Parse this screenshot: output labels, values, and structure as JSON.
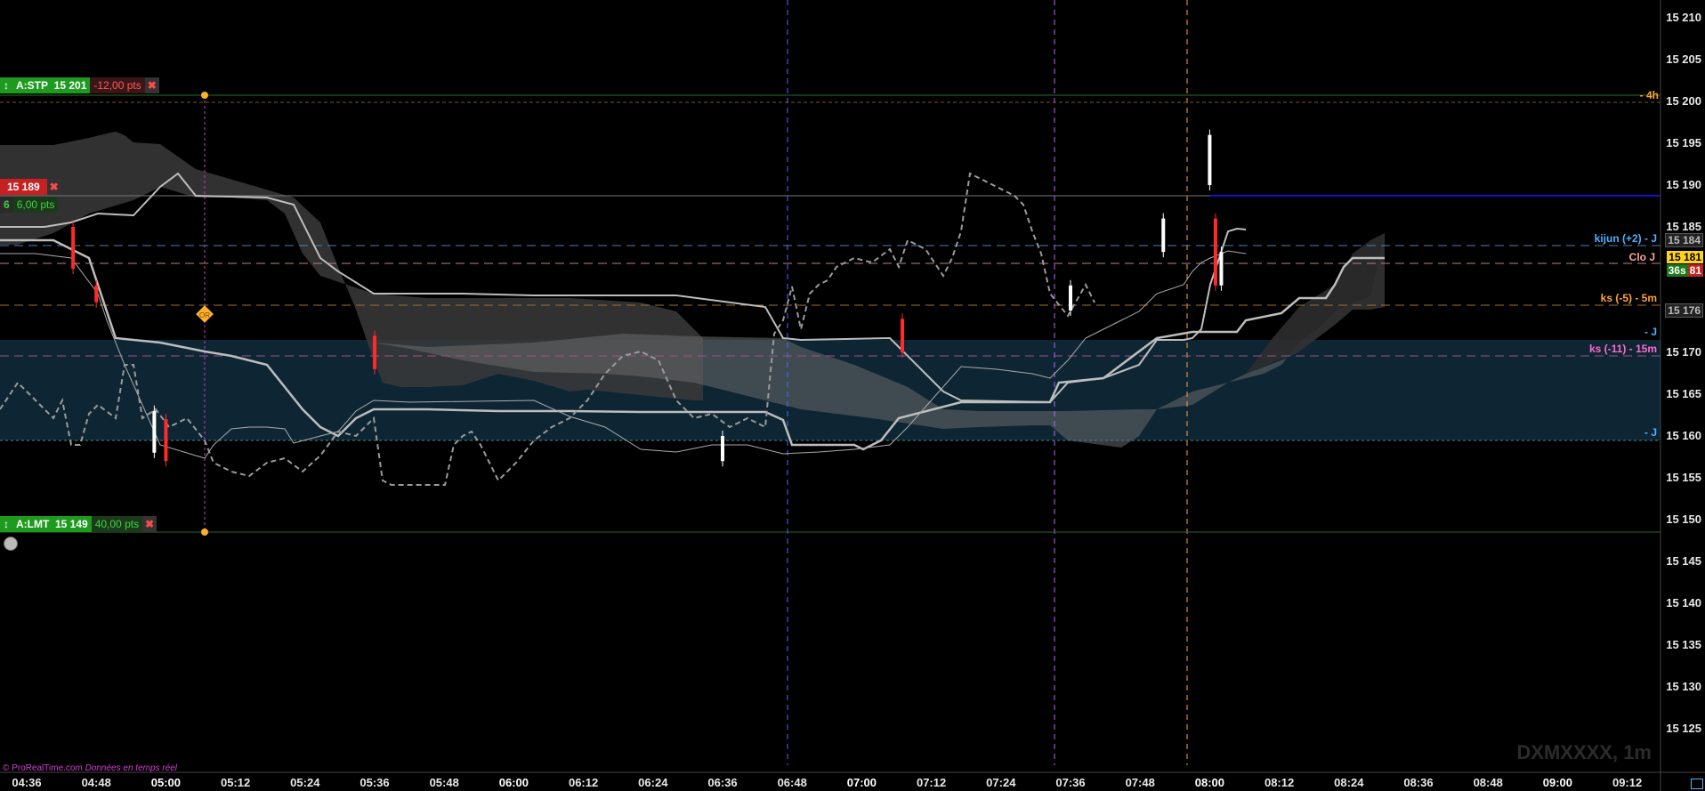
{
  "instrument": "DXMXXXX, 1m",
  "footer": {
    "site": "© ProRealTime.com",
    "note": "Données en temps réel"
  },
  "orders": {
    "stop": {
      "label": "A:STP",
      "price": "15 201",
      "pts": "-12,00 pts",
      "value": 15201
    },
    "limit": {
      "label": "A:LMT",
      "price": "15 149",
      "pts": "40,00 pts",
      "value": 15149
    },
    "position": {
      "price": "15 189",
      "qty": "6",
      "pts": "6,00 pts"
    }
  },
  "levels": [
    {
      "name": "4h",
      "label": "- 4h",
      "value": 15200,
      "color": "#ffa23a"
    },
    {
      "name": "kijun",
      "label": "kijun (+2) - J",
      "value": 15183.5,
      "color": "#4fb0ff"
    },
    {
      "name": "clo",
      "label": "Clo J",
      "value": 15181,
      "color": "#ffa0a0"
    },
    {
      "name": "ks5",
      "label": "ks (-5) - 5m",
      "value": 15176,
      "color": "#ffa23a"
    },
    {
      "name": "j1",
      "label": "- J",
      "value": 15173,
      "color": "#4fb0ff"
    },
    {
      "name": "ks11",
      "label": "ks (-11) - 15m",
      "value": 15171,
      "color": "#ff6ad0"
    },
    {
      "name": "j2",
      "label": "- J",
      "value": 15160,
      "color": "#4fb0ff"
    }
  ],
  "price_axis": {
    "ticks": [
      "15 210",
      "15 205",
      "15 200",
      "15 195",
      "15 190",
      "15 185",
      "15 180",
      "15 175",
      "15 170",
      "15 165",
      "15 160",
      "15 155",
      "15 150",
      "15 145",
      "15 140",
      "15 135",
      "15 130",
      "15 125"
    ],
    "last_price": "15 181",
    "countdown": "36s",
    "countdown_val": "81",
    "price_184": "15 184",
    "price_176": "15 176"
  },
  "time_axis": [
    "04:36",
    "04:48",
    "05:00",
    "05:12",
    "05:24",
    "05:36",
    "05:48",
    "06:00",
    "06:12",
    "06:24",
    "06:36",
    "06:48",
    "07:00",
    "07:12",
    "07:24",
    "07:36",
    "07:48",
    "08:00",
    "08:12",
    "08:24",
    "08:36",
    "08:48",
    "09:00",
    "09:12"
  ],
  "colors": {
    "bull": "#ffffff",
    "bear": "#ff2a2a",
    "band": "#0e2633",
    "cloud": "#555555"
  },
  "chart_data": {
    "type": "candlestick",
    "ylim": [
      15122,
      15212
    ],
    "x_range": [
      "04:34",
      "09:17"
    ],
    "candles_approx": [
      {
        "t": "04:44",
        "o": 15185,
        "c": 15180
      },
      {
        "t": "04:48",
        "o": 15178,
        "c": 15176
      },
      {
        "t": "04:58",
        "o": 15158,
        "c": 15163
      },
      {
        "t": "05:00",
        "o": 15162,
        "c": 15157
      },
      {
        "t": "05:36",
        "o": 15172,
        "c": 15168
      },
      {
        "t": "06:36",
        "o": 15157,
        "c": 15160
      },
      {
        "t": "07:07",
        "o": 15174,
        "c": 15170
      },
      {
        "t": "07:36",
        "o": 15175,
        "c": 15178
      },
      {
        "t": "07:52",
        "o": 15182,
        "c": 15186
      },
      {
        "t": "08:00",
        "o": 15190,
        "c": 15196
      },
      {
        "t": "08:01",
        "o": 15186,
        "c": 15178
      },
      {
        "t": "08:02",
        "o": 15178,
        "c": 15182
      }
    ]
  }
}
